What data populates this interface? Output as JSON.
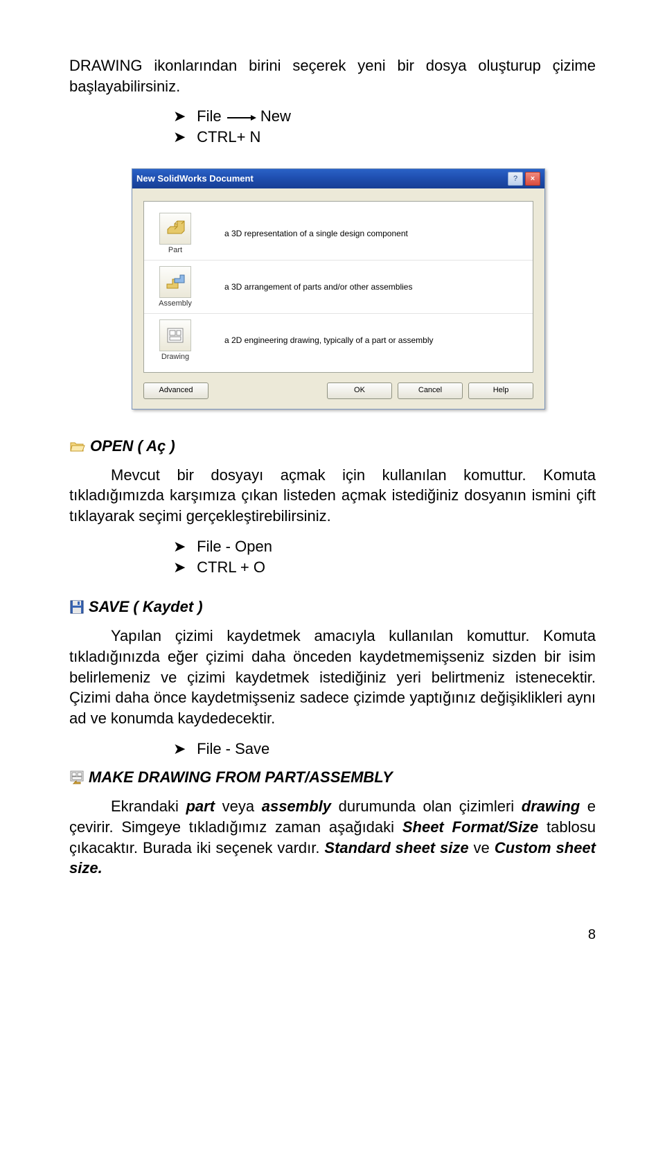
{
  "intro": {
    "text": "DRAWING ikonlarından birini seçerek yeni bir dosya oluşturup çizime başlayabilirsiniz."
  },
  "bullets1": {
    "arrow": "➤",
    "line1a": "File",
    "line1b": "New",
    "line2": "CTRL+ N"
  },
  "dialog": {
    "title": "New SolidWorks Document",
    "help_glyph": "?",
    "close_glyph": "×",
    "rows": [
      {
        "label": "Part",
        "desc": "a 3D representation of a single design component",
        "icon": "part"
      },
      {
        "label": "Assembly",
        "desc": "a 3D arrangement of parts and/or other assemblies",
        "icon": "assembly"
      },
      {
        "label": "Drawing",
        "desc": "a 2D engineering drawing, typically of a part or assembly",
        "icon": "drawing"
      }
    ],
    "advanced": "Advanced",
    "ok": "OK",
    "cancel": "Cancel",
    "help": "Help"
  },
  "open": {
    "heading": "OPEN  ( Aç )",
    "para": "Mevcut bir dosyayı açmak için kullanılan komuttur. Komuta tıkladığımızda karşımıza çıkan listeden açmak istediğiniz dosyanın ismini çift tıklayarak seçimi gerçekleştirebilirsiniz.",
    "bullets": {
      "arrow": "➤",
      "line1": "File  -  Open",
      "line2": "CTRL + O"
    }
  },
  "save": {
    "heading": "SAVE ( Kaydet )",
    "para": "Yapılan çizimi kaydetmek amacıyla kullanılan komuttur. Komuta tıkladığınızda eğer çizimi daha önceden kaydetmemişseniz sizden bir isim belirlemeniz ve çizimi kaydetmek istediğiniz yeri belirtmeniz istenecektir. Çizimi daha önce kaydetmişseniz sadece çizimde yaptığınız değişiklikleri aynı ad ve konumda kaydedecektir.",
    "bullet_arrow": "➤",
    "bullet_line": "File  -  Save"
  },
  "make": {
    "heading": "MAKE DRAWING FROM PART/ASSEMBLY",
    "p1a": "Ekrandaki ",
    "p1_part": "part",
    "p1b": " veya ",
    "p1_asm": "assembly",
    "p1c": " durumunda olan çizimleri ",
    "p1_drw": "drawing",
    "p1d": " e çevirir. Simgeye tıkladığımız zaman aşağıdaki ",
    "p1_sfs": "Sheet Format/Size",
    "p1e": " tablosu çıkacaktır. Burada iki seçenek vardır. ",
    "p1_std": "Standard sheet size",
    "p1f": " ve ",
    "p1_cus": "Custom sheet size.",
    "p1g": ""
  },
  "pagenum": "8"
}
